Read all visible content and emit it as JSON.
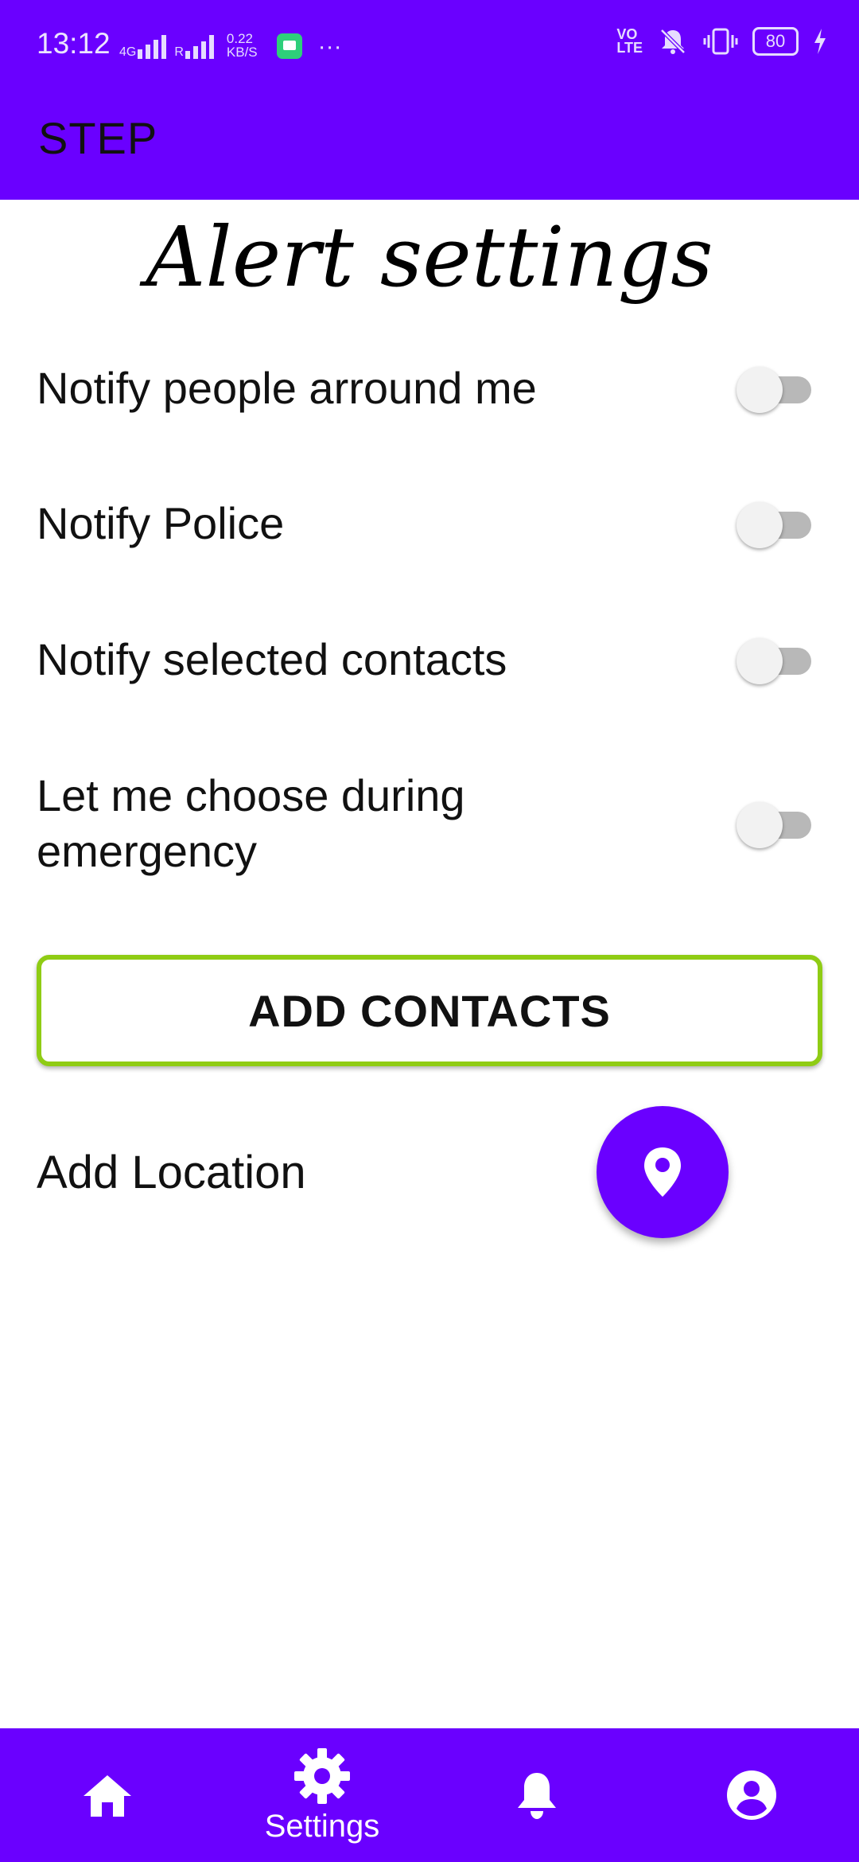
{
  "status_bar": {
    "time": "13:12",
    "network_type": "4G",
    "roaming": "R",
    "speed_value": "0.22",
    "speed_unit": "KB/S",
    "more": "···",
    "volte_top": "VO",
    "volte_bottom": "LTE",
    "battery": "80"
  },
  "app_bar": {
    "title": "STEP"
  },
  "page": {
    "heading": "Alert settings"
  },
  "settings": {
    "items": [
      {
        "label": "Notify people arround me",
        "enabled": false
      },
      {
        "label": "Notify Police",
        "enabled": false
      },
      {
        "label": "Notify selected contacts",
        "enabled": false
      },
      {
        "label": "Let me choose during emergency",
        "enabled": false
      }
    ]
  },
  "actions": {
    "add_contacts_label": "ADD CONTACTS",
    "add_location_label": "Add Location"
  },
  "bottom_nav": {
    "items": [
      {
        "icon": "home-icon",
        "label": ""
      },
      {
        "icon": "gear-icon",
        "label": "Settings"
      },
      {
        "icon": "bell-icon",
        "label": ""
      },
      {
        "icon": "account-icon",
        "label": ""
      }
    ],
    "selected": "Settings"
  },
  "colors": {
    "primary": "#6a00ff",
    "button_border": "#8fcc14",
    "toggle_track": "#b8b8b8",
    "toggle_thumb": "#f2f2f2"
  }
}
